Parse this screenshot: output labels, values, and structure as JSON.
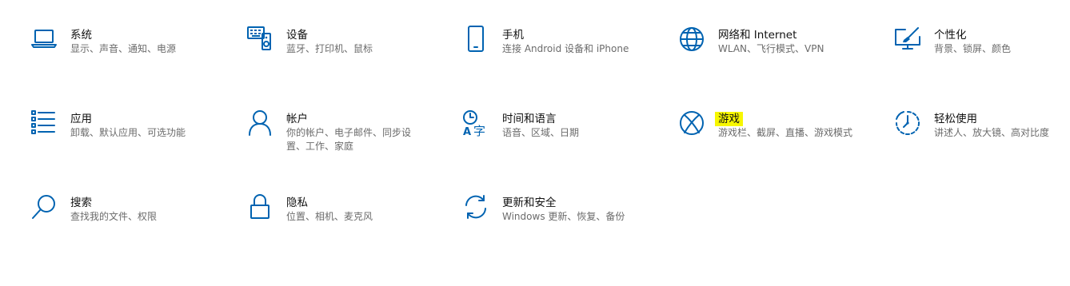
{
  "accent_color": "#0063b1",
  "highlight_color": "#f7f700",
  "tiles": [
    {
      "title": "系统",
      "desc": "显示、声音、通知、电源",
      "icon": "laptop-icon"
    },
    {
      "title": "设备",
      "desc": "蓝牙、打印机、鼠标",
      "icon": "keyboard-speaker-icon"
    },
    {
      "title": "手机",
      "desc": "连接 Android 设备和 iPhone",
      "icon": "phone-icon"
    },
    {
      "title": "网络和 Internet",
      "desc": "WLAN、飞行模式、VPN",
      "icon": "globe-icon"
    },
    {
      "title": "个性化",
      "desc": "背景、锁屏、颜色",
      "icon": "paintbrush-monitor-icon"
    },
    {
      "title": "应用",
      "desc": "卸载、默认应用、可选功能",
      "icon": "apps-list-icon"
    },
    {
      "title": "帐户",
      "desc": "你的帐户、电子邮件、同步设置、工作、家庭",
      "icon": "person-icon"
    },
    {
      "title": "时间和语言",
      "desc": "语音、区域、日期",
      "icon": "clock-language-icon"
    },
    {
      "title": "游戏",
      "desc": "游戏栏、截屏、直播、游戏模式",
      "icon": "xbox-icon"
    },
    {
      "title": "轻松使用",
      "desc": "讲述人、放大镜、高对比度",
      "icon": "ease-of-access-icon"
    },
    {
      "title": "搜索",
      "desc": "查找我的文件、权限",
      "icon": "search-icon"
    },
    {
      "title": "隐私",
      "desc": "位置、相机、麦克风",
      "icon": "lock-icon"
    },
    {
      "title": "更新和安全",
      "desc": "Windows 更新、恢复、备份",
      "icon": "sync-icon"
    }
  ]
}
